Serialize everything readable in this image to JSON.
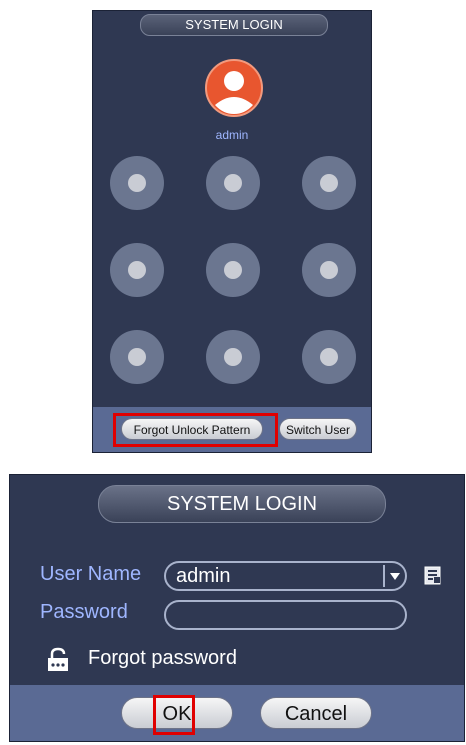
{
  "pattern_login": {
    "title": "SYSTEM LOGIN",
    "username": "admin",
    "forgot_pattern_label": "Forgot Unlock Pattern",
    "switch_user_label": "Switch User",
    "pattern_dot_count": 9
  },
  "password_login": {
    "title": "SYSTEM LOGIN",
    "user_name_label": "User Name",
    "user_name_value": "admin",
    "password_label": "Password",
    "password_value": "",
    "forgot_password_label": "Forgot password",
    "ok_label": "OK",
    "cancel_label": "Cancel"
  },
  "colors": {
    "panel_bg": "#2f3852",
    "footer_bg": "#5a6a94",
    "label_blue": "#9fb6ff",
    "highlight_red": "#e00000",
    "avatar_orange": "#e8562f"
  },
  "icons": {
    "avatar": "user-avatar-icon",
    "dropdown": "chevron-down-icon",
    "keyboard": "keyboard-icon",
    "lock": "lock-icon"
  }
}
